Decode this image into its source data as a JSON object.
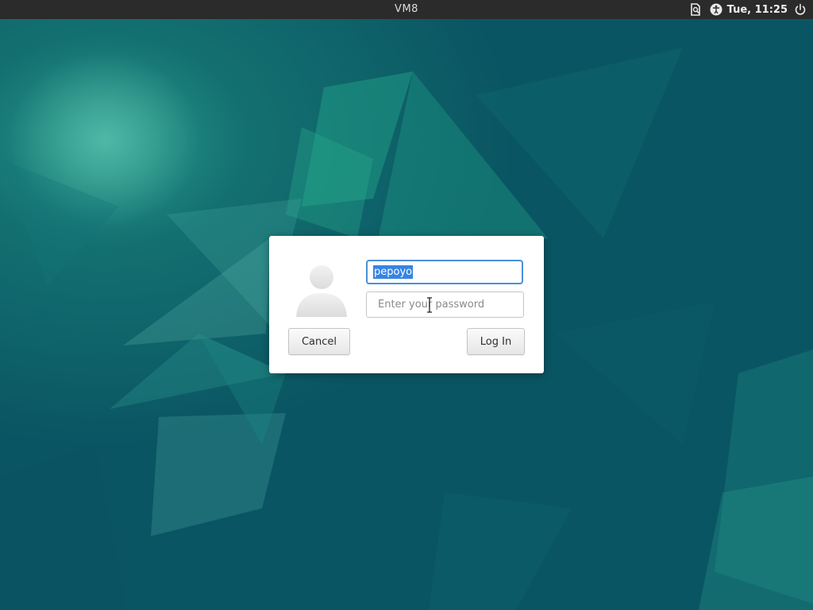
{
  "topbar": {
    "host": "VM8",
    "clock": "Tue, 11:25",
    "icons": [
      "screen-reader-icon",
      "accessibility-icon",
      "power-icon"
    ]
  },
  "login": {
    "username": "pepoyo",
    "password_placeholder": "Enter your password",
    "cancel_label": "Cancel",
    "login_label": "Log In"
  },
  "colors": {
    "background": "#0b5d66",
    "topbar": "#2b2b2b",
    "selection": "#3584e4",
    "focus_border": "#4a90d9"
  }
}
